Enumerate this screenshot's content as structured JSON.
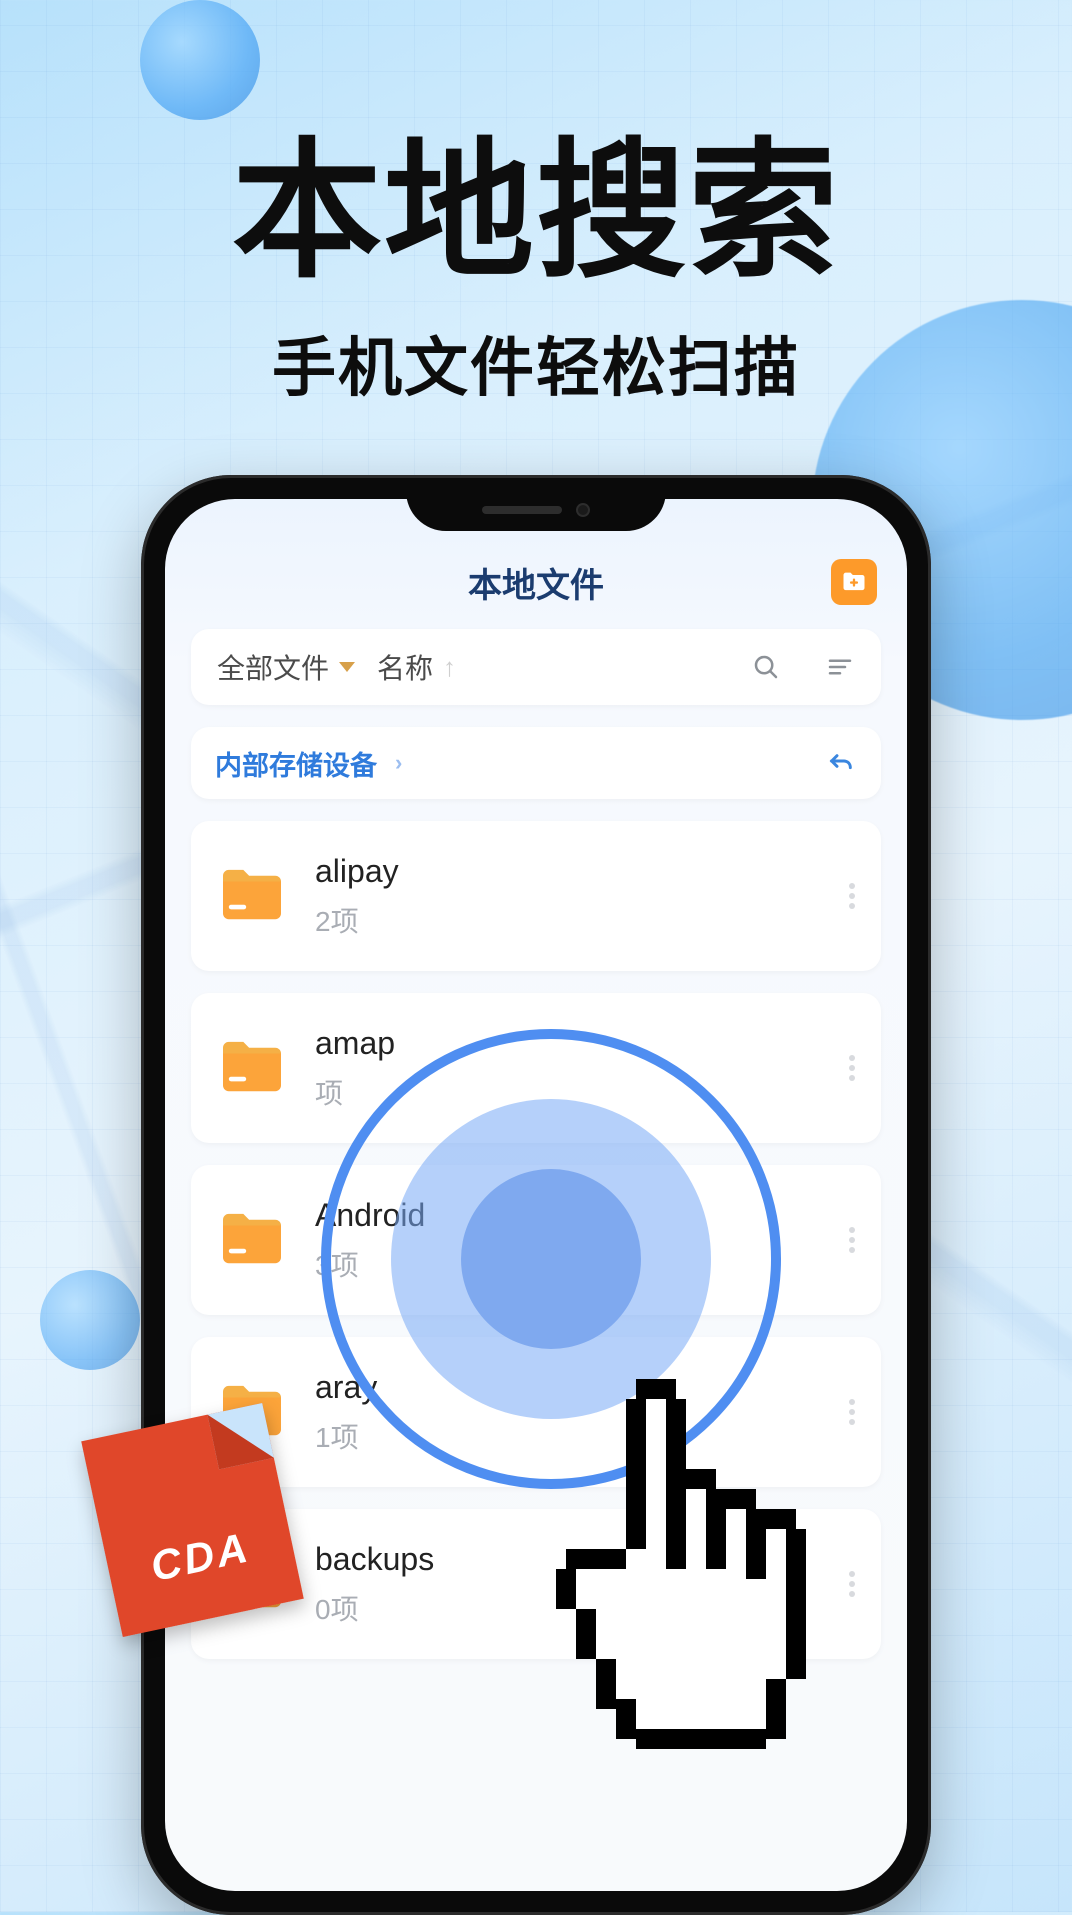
{
  "hero": {
    "title": "本地搜索",
    "subtitle": "手机文件轻松扫描"
  },
  "app": {
    "title": "本地文件",
    "toolbar": {
      "filter_label": "全部文件",
      "sort_label": "名称"
    },
    "breadcrumb": {
      "root": "内部存储设备"
    },
    "folders": [
      {
        "name": "alipay",
        "meta": "2项"
      },
      {
        "name": "amap",
        "meta": "项"
      },
      {
        "name": "Android",
        "meta": "3项"
      },
      {
        "name": "aray",
        "meta": "1项"
      },
      {
        "name": "backups",
        "meta": "0项"
      }
    ]
  },
  "badge": {
    "label": "CDA"
  }
}
